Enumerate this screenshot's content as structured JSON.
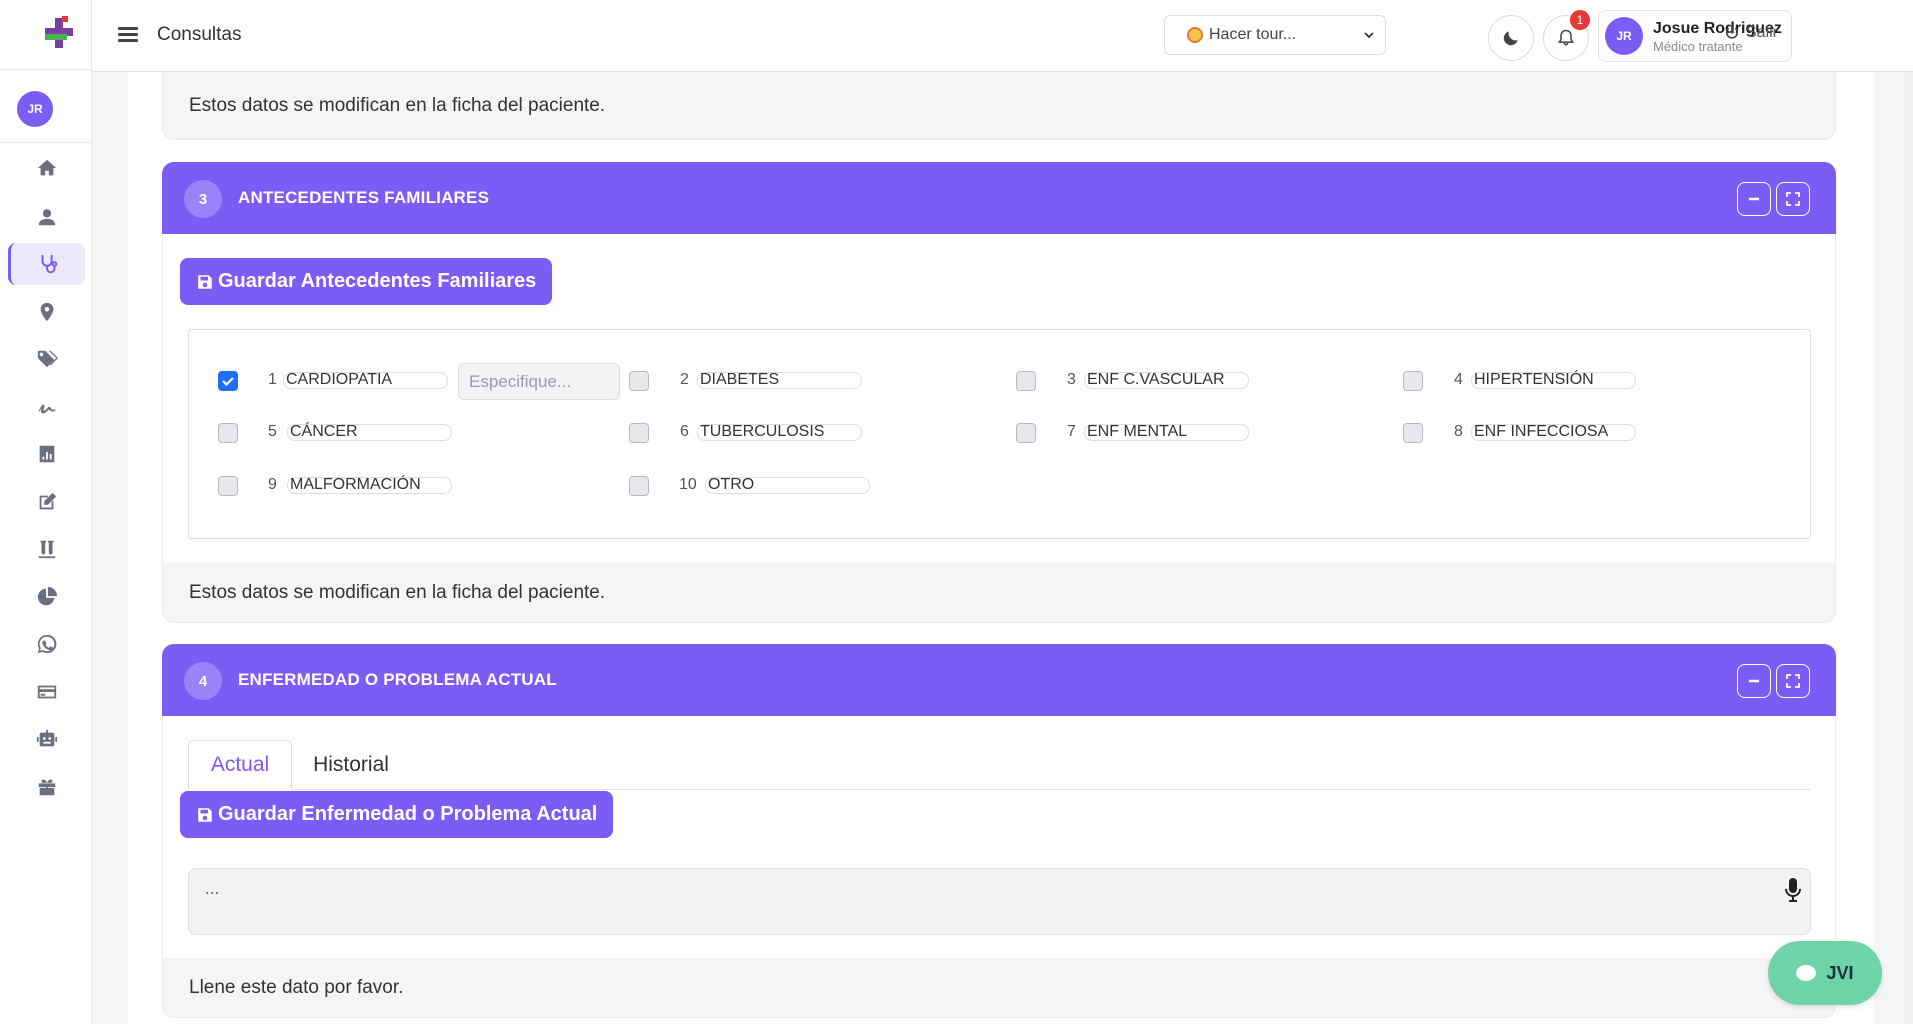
{
  "topbar": {
    "page_title": "Consultas",
    "tour_select": "Hacer tour...",
    "notification_count": "1",
    "user_initials": "JR",
    "user_name": "Josue Rodriguez",
    "user_role": "Médico tratante",
    "logout": "Salir"
  },
  "sidebar": {
    "avatar": "JR",
    "items": [
      "home-icon",
      "user-icon",
      "stethoscope-icon",
      "location-icon",
      "tags-icon",
      "signature-icon",
      "chart-icon",
      "edit-icon",
      "lab-icon",
      "pie-chart-icon",
      "whatsapp-icon",
      "credit-card-icon",
      "robot-icon",
      "gift-icon"
    ],
    "active_item": "stethoscope-icon"
  },
  "notes": {
    "top": "Estos datos se modifican en la ficha del paciente.",
    "section3": "Estos datos se modifican en la ficha del paciente.",
    "section4": "Llene este dato por favor."
  },
  "section3": {
    "number": "3",
    "title": "ANTECEDENTES FAMILIARES",
    "save_label": "Guardar Antecedentes Familiares",
    "specify_placeholder": "Especifique...",
    "items": [
      {
        "num": "1",
        "label": "CARDIOPATIA",
        "checked": true
      },
      {
        "num": "2",
        "label": "DIABETES",
        "checked": false
      },
      {
        "num": "3",
        "label": "ENF C.VASCULAR",
        "checked": false
      },
      {
        "num": "4",
        "label": "HIPERTENSIÓN",
        "checked": false
      },
      {
        "num": "5",
        "label": "CÁNCER",
        "checked": false
      },
      {
        "num": "6",
        "label": "TUBERCULOSIS",
        "checked": false
      },
      {
        "num": "7",
        "label": "ENF MENTAL",
        "checked": false
      },
      {
        "num": "8",
        "label": "ENF INFECCIOSA",
        "checked": false
      },
      {
        "num": "9",
        "label": "MALFORMACIÓN",
        "checked": false
      },
      {
        "num": "10",
        "label": "OTRO",
        "checked": false
      }
    ]
  },
  "section4": {
    "number": "4",
    "title": "ENFERMEDAD O PROBLEMA ACTUAL",
    "tabs": [
      "Actual",
      "Historial"
    ],
    "save_label": "Guardar Enfermedad o Problema Actual",
    "textarea_value": "..."
  },
  "chat": {
    "label": "JVI"
  },
  "colors": {
    "primary": "#7b5cf5",
    "checkbox_checked": "#1e6ff1",
    "chat": "#6ed3a8"
  }
}
